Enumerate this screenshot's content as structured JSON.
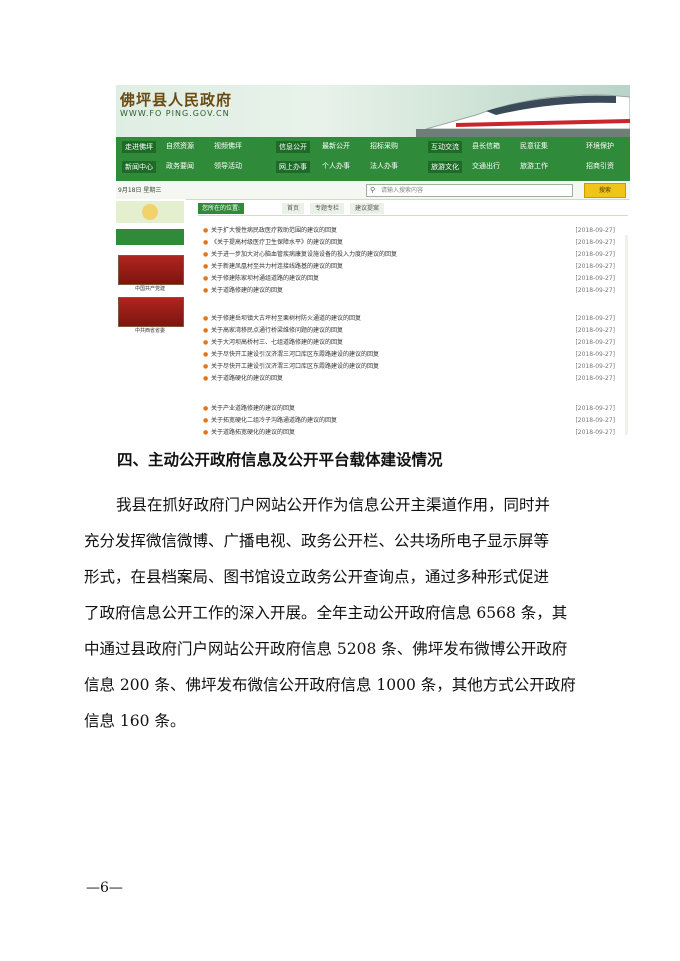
{
  "site": {
    "name": "佛坪县人民政府",
    "url": "WWW.FO PING.GOV.CN"
  },
  "nav": {
    "row1": [
      "走进佛坪",
      "自然资源",
      "视频佛坪",
      "信息公开",
      "最新公开",
      "招标采购",
      "互动交流",
      "县长信箱",
      "民意征集",
      "环境保护"
    ],
    "row2": [
      "新闻中心",
      "政务要闻",
      "领导活动",
      "网上办事",
      "个人办事",
      "法人办事",
      "旅游文化",
      "交通出行",
      "旅游工作",
      "招商引资"
    ]
  },
  "search": {
    "date_text": "9月18日 星期三",
    "placeholder": "请输入搜索内容",
    "button": "搜索"
  },
  "sidebar": {
    "caption1": "中国共产党建",
    "caption2": "中共西省省委"
  },
  "breadcrumb": {
    "here": "您所在的位置:",
    "items": [
      "首页",
      "专题专栏",
      "建议提案"
    ]
  },
  "list_group1": [
    {
      "title": "关于扩大慢性病民政医疗救助范围的建议的回复",
      "date": "[2018-09-27]"
    },
    {
      "title": "《关于提高村级医疗卫生保障水平》的建议的回复",
      "date": "[2018-09-27]"
    },
    {
      "title": "关于进一步加大对心脑血管疾病康复设施设备的投入力度的建议的回复",
      "date": "[2018-09-27]"
    },
    {
      "title": "关于新建凤凰村至共力村连接线路基的建议的回复",
      "date": "[2018-09-27]"
    },
    {
      "title": "关于修建陈家坝村通组道路的建议的回复",
      "date": "[2018-09-27]"
    },
    {
      "title": "关于道路修建的建议的回复",
      "date": "[2018-09-27]"
    }
  ],
  "list_group2": [
    {
      "title": "关于修建岳坝镇大古坪村至栗树村防火通道的建议的回复",
      "date": "[2018-09-27]"
    },
    {
      "title": "关于高家湾移民点通行桥梁维修问题的建议的回复",
      "date": "[2018-09-27]"
    },
    {
      "title": "关于大河坝高桥村三、七组道路修建的建议的回复",
      "date": "[2018-09-27]"
    },
    {
      "title": "关于尽快开工建设引汉济渭三河口库区东霞路建设的建议的回复",
      "date": "[2018-09-27]"
    },
    {
      "title": "关于尽快开工建设引汉济渭三河口库区东霞路建设的建议的回复",
      "date": "[2018-09-27]"
    },
    {
      "title": "关于道路硬化的建议的回复",
      "date": "[2018-09-27]"
    }
  ],
  "list_group3": [
    {
      "title": "关于产业道路修建的建议的回复",
      "date": "[2018-09-27]"
    },
    {
      "title": "关于拓宽硬化二组冷子沟路通道路的建议的回复",
      "date": "[2018-09-27]"
    },
    {
      "title": "关于道路拓宽硬化的建议的回复",
      "date": "[2018-09-27]"
    }
  ],
  "doc": {
    "heading": "四、主动公开政府信息及公开平台载体建设情况",
    "lines": [
      "我县在抓好政府门户网站公开作为信息公开主渠道作用，同时并",
      "充分发挥微信微博、广播电视、政务公开栏、公共场所电子显示屏等",
      "形式，在县档案局、图书馆设立政务公开查询点，通过多种形式促进",
      "了政府信息公开工作的深入开展。全年主动公开政府信息 6568 条，其",
      "中通过县政府门户网站公开政府信息 5208 条、佛坪发布微博公开政府",
      "信息 200 条、佛坪发布微信公开政府信息 1000 条，其他方式公开政府",
      "信息 160 条。"
    ],
    "page_number": "—6—"
  }
}
